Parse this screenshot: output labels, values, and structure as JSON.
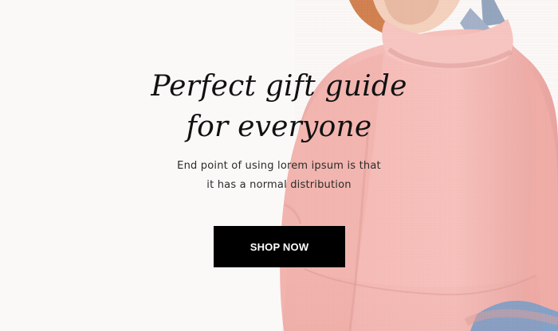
{
  "hero": {
    "headline_line_1": "Perfect gift guide",
    "headline_line_2": "for everyone",
    "subtext_line_1": "End point of using lorem ipsum is that",
    "subtext_line_2": "it has a normal distribution",
    "button_label": "SHOP NOW",
    "image_subject": "model-wearing-pink-sweater"
  },
  "colors": {
    "background": "#faf9f8",
    "sweater_pink": "#f3b8b3",
    "button_black": "#000000",
    "button_text": "#ffffff"
  }
}
